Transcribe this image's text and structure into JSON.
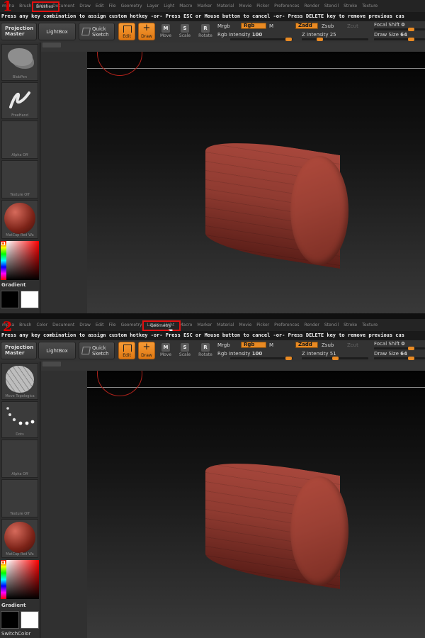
{
  "menu_items": [
    "mpha",
    "Brush",
    "Color",
    "Document",
    "Draw",
    "Edit",
    "File",
    "Geometry",
    "Layer",
    "Light",
    "Macro",
    "Marker",
    "Material",
    "Movie",
    "Picker",
    "Preferences",
    "Render",
    "Stencil",
    "Stroke",
    "Texture"
  ],
  "hint_text": "Press any key combination to assign custom hotkey -or- Press ESC or Mouse button to cancel -or- Press DELETE key to remove previous cus",
  "toolbar": {
    "projection_master": "Projection Master",
    "lightbox": "LightBox",
    "quick_sketch": "Quick Sketch",
    "edit": "Edit",
    "draw": "Draw",
    "move": "Move",
    "scale": "Scale",
    "rotate": "Rotate",
    "move_glyph": "M",
    "scale_glyph": "S",
    "rotate_glyph": "R",
    "mrgb": "Mrgb",
    "rgb": "Rgb",
    "m": "M",
    "zadd": "Zadd",
    "zsub": "Zsub",
    "zcut": "Zcut",
    "focal_shift": "Focal Shift",
    "draw_size": "Draw Size",
    "rgb_intensity": "Rgb Intensity"
  },
  "panels": [
    {
      "step": "1",
      "highlighted_menu": "Brushes",
      "rgb_intensity": "100",
      "z_intensity_label": "Z Intensity 25",
      "z_intensity_value": 25,
      "focal_shift": "0",
      "draw_size": "64",
      "slots": [
        "BlobPen",
        "FreeHand",
        "Alpha Off",
        "Texture Off",
        "MatCap Red Wa"
      ],
      "gradient_label": "Gradient",
      "bottom_label": ""
    },
    {
      "step": "2",
      "highlighted_menu": "Geometry",
      "rgb_intensity": "100",
      "z_intensity_label": "Z Intensity 51",
      "z_intensity_value": 51,
      "focal_shift": "0",
      "draw_size": "64",
      "slots": [
        "Move Topologica",
        "Dots",
        "Alpha Off",
        "Texture Off",
        "MatCap Red Wa"
      ],
      "gradient_label": "Gradient",
      "bottom_label": "SwitchColor"
    }
  ]
}
